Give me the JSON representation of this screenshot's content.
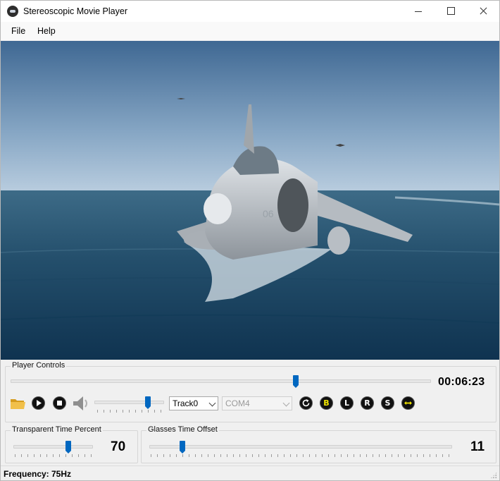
{
  "window": {
    "title": "Stereoscopic Movie Player"
  },
  "menu": {
    "items": [
      "File",
      "Help"
    ]
  },
  "video": {
    "description_icon": "video-frame"
  },
  "player_controls": {
    "label": "Player Controls",
    "time": "00:06:23",
    "seek_position": 0.68,
    "volume_position": 0.78,
    "track_select": {
      "value": "Track0"
    },
    "port_select": {
      "value": "COM4",
      "enabled": false
    },
    "buttons": {
      "open": "folder-open-icon",
      "play": "play-icon",
      "stop": "stop-icon",
      "mute": "speaker-icon",
      "reset": "refresh-icon",
      "both": "B",
      "left": "L",
      "right": "R",
      "swap_s": "S",
      "swap_eyes": "swap-arrows-icon"
    }
  },
  "transparent_time": {
    "label": "Transparent Time Percent",
    "value": "70",
    "position": 0.7
  },
  "glasses_offset": {
    "label": "Glasses Time Offset",
    "value": "11",
    "position": 0.11
  },
  "status": {
    "label": "Frequency:",
    "value": "75Hz"
  },
  "colors": {
    "accent": "#0067c0",
    "yellow_button": "#f2e600",
    "window_bg": "#f0f0f0"
  }
}
